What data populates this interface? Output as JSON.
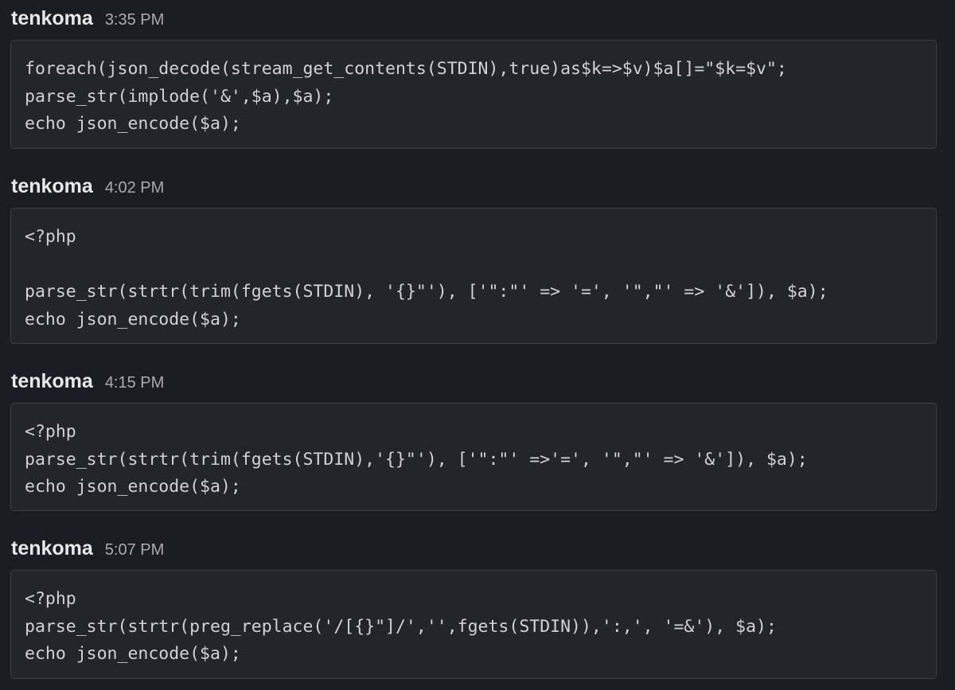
{
  "messages": [
    {
      "sender": "tenkoma",
      "time": "3:35 PM",
      "code_lines": [
        "foreach(json_decode(stream_get_contents(STDIN),true)as$k=>$v)$a[]=\"$k=$v\";",
        "parse_str(implode('&',$a),$a);",
        "echo json_encode($a);"
      ]
    },
    {
      "sender": "tenkoma",
      "time": "4:02 PM",
      "code_lines": [
        "<?php",
        "",
        "parse_str(strtr(trim(fgets(STDIN), '{}\"'), ['\":\"' => '=', '\",\"' => '&']), $a);",
        "echo json_encode($a);"
      ]
    },
    {
      "sender": "tenkoma",
      "time": "4:15 PM",
      "code_lines": [
        "<?php",
        "parse_str(strtr(trim(fgets(STDIN),'{}\"'), ['\":\"' =>'=', '\",\"' => '&']), $a);",
        "echo json_encode($a);"
      ]
    },
    {
      "sender": "tenkoma",
      "time": "5:07 PM",
      "code_lines": [
        "<?php",
        "parse_str(strtr(preg_replace('/[{}\"]/','',fgets(STDIN)),':,', '=&'), $a);",
        "echo json_encode($a);"
      ]
    }
  ]
}
